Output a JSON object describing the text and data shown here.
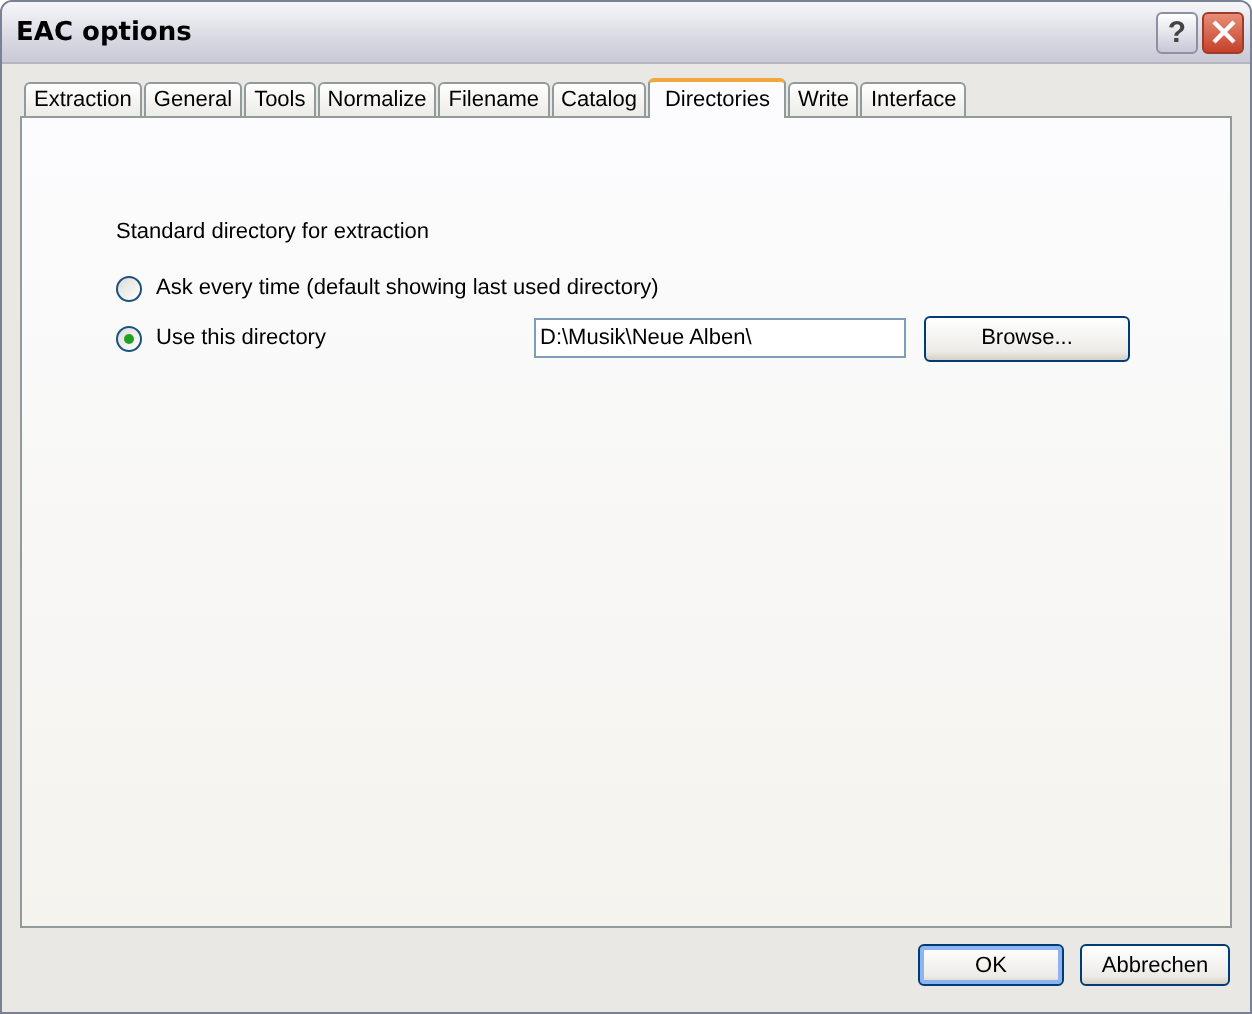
{
  "window": {
    "title": "EAC options",
    "help_label": "?"
  },
  "tabs": [
    {
      "label": "Extraction",
      "selected": false
    },
    {
      "label": "General",
      "selected": false
    },
    {
      "label": "Tools",
      "selected": false
    },
    {
      "label": "Normalize",
      "selected": false
    },
    {
      "label": "Filename",
      "selected": false
    },
    {
      "label": "Catalog",
      "selected": false
    },
    {
      "label": "Directories",
      "selected": true
    },
    {
      "label": "Write",
      "selected": false
    },
    {
      "label": "Interface",
      "selected": false
    }
  ],
  "group_label": "Standard directory for extraction",
  "options": [
    {
      "label": "Ask every time (default showing last used directory)",
      "selected": false
    },
    {
      "label": "Use this directory",
      "selected": true
    }
  ],
  "directory_field": {
    "value": "D:\\Musik\\Neue Alben\\"
  },
  "browse_button": "Browse...",
  "buttons": [
    {
      "label": "OK",
      "default": true
    },
    {
      "label": "Abbrechen",
      "default": false
    }
  ]
}
